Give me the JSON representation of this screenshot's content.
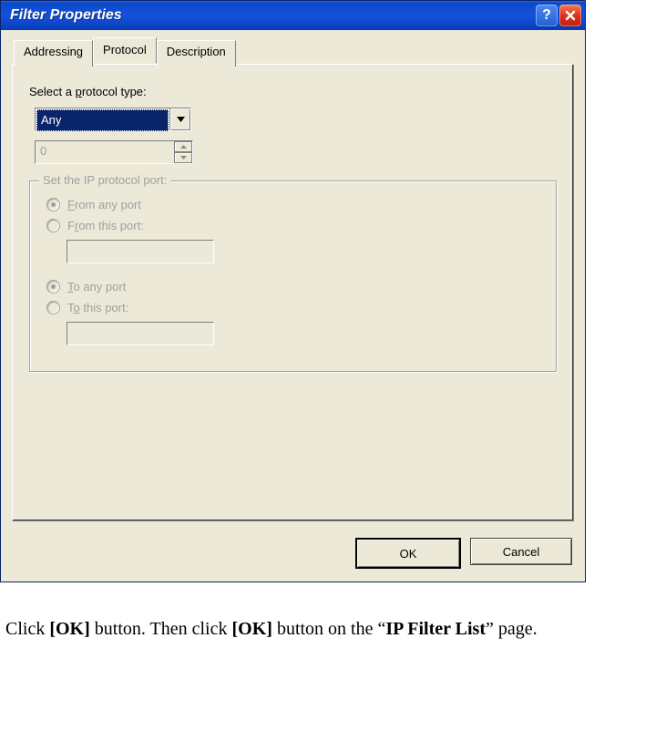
{
  "dialog": {
    "title": "Filter Properties",
    "tabs": {
      "addressing": "Addressing",
      "protocol": "Protocol",
      "description": "Description"
    },
    "protocol": {
      "select_label_pre": "Select a ",
      "select_label_ul": "p",
      "select_label_post": "rotocol type:",
      "combo_value": "Any",
      "spinner_value": "0",
      "group_title": "Set the IP protocol port:",
      "from_any_ul": "F",
      "from_any_post": "rom any port",
      "from_this_pre": "F",
      "from_this_ul": "r",
      "from_this_post": "om this port:",
      "to_any_ul": "T",
      "to_any_post": "o any port",
      "to_this_pre": "T",
      "to_this_ul": "o",
      "to_this_post": " this port:"
    },
    "buttons": {
      "ok": "OK",
      "cancel": "Cancel"
    }
  },
  "caption": {
    "p1": "Click ",
    "b1": "[OK]",
    "p2": " button. Then click ",
    "b2": "[OK]",
    "p3": " button on the “",
    "b3": "IP Filter List",
    "p4": "” page."
  }
}
